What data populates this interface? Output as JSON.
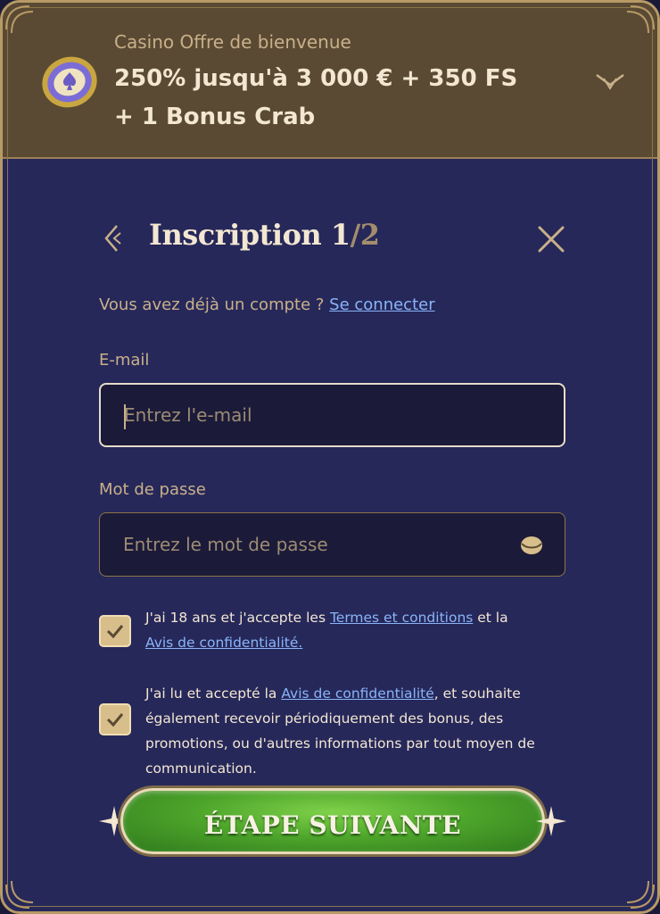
{
  "offer": {
    "kicker": "Casino Offre de bienvenue",
    "title": "250% jusqu'à 3 000 € + 350 FS + 1 Bonus Crab",
    "chip_icon": "casino-chip-icon",
    "toggle_icon": "chevron-down-icon"
  },
  "registration": {
    "title": "Inscription 1",
    "step_separator": "/2",
    "back_icon": "chevron-left-icon",
    "close_icon": "close-icon"
  },
  "login_prompt": {
    "text": "Vous avez déjà un compte ? ",
    "link": "Se connecter"
  },
  "email": {
    "label": "E-mail",
    "placeholder": "Entrez l'e-mail",
    "value": ""
  },
  "password": {
    "label": "Mot de passe",
    "placeholder": "Entrez le mot de passe",
    "value": "",
    "toggle_icon": "eye-icon"
  },
  "consents": [
    {
      "checked": true,
      "text_before": "J'ai 18 ans et j'accepte les ",
      "link1": "Termes et conditions",
      "text_middle": " et la ",
      "link2": "Avis de confidentialité.",
      "text_after": ""
    },
    {
      "checked": true,
      "text_before": "J'ai lu et accepté la ",
      "link1": "Avis de confidentialité",
      "text_after": ", et souhaite également recevoir périodiquement des bonus, des promotions, ou d'autres informations par tout moyen de communication."
    }
  ],
  "next_button": {
    "label": "ÉTAPE SUIVANTE"
  },
  "colors": {
    "panel": "#26285a",
    "header": "#5a4a33",
    "gold": "#c9b08a",
    "link": "#8ab4f8",
    "button_green": "#4ea62b"
  }
}
